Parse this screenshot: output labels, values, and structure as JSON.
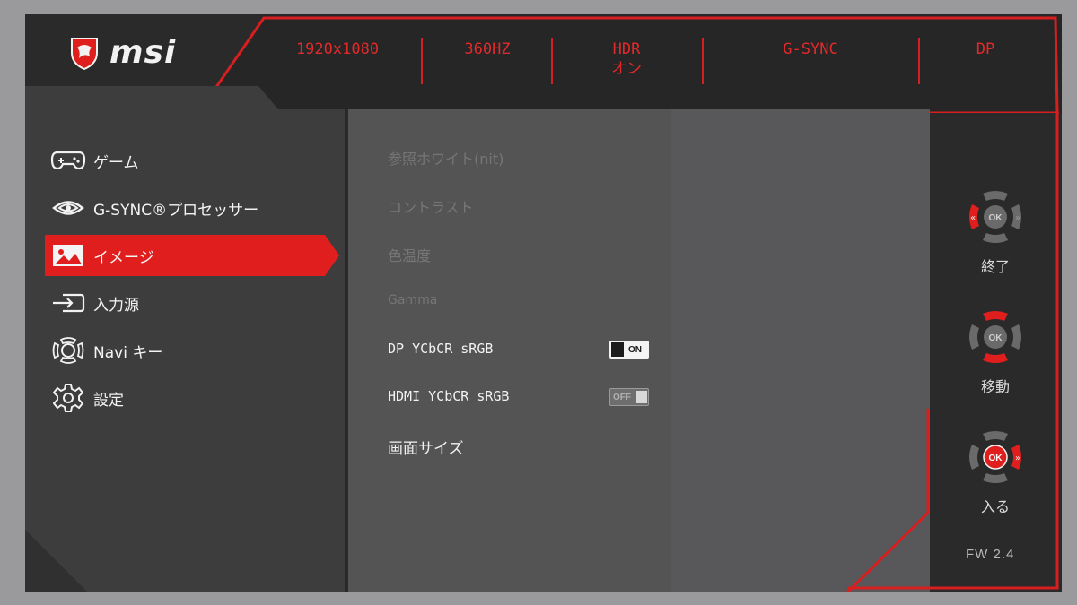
{
  "brand": {
    "name": "msi"
  },
  "status_bar": [
    {
      "text": "1920x1080"
    },
    {
      "text": "360HZ"
    },
    {
      "text": "HDR\nオン"
    },
    {
      "text": "G-SYNC"
    },
    {
      "text": "DP"
    }
  ],
  "menu": [
    {
      "label": "ゲーム",
      "icon": "gamepad-icon"
    },
    {
      "label": "G-SYNC®プロセッサー",
      "icon": "nvidia-eye-icon"
    },
    {
      "label": "イメージ",
      "icon": "image-icon",
      "active": true
    },
    {
      "label": "入力源",
      "icon": "input-source-icon"
    },
    {
      "label": "Navi キー",
      "icon": "navi-key-icon"
    },
    {
      "label": "設定",
      "icon": "gear-icon"
    }
  ],
  "settings": [
    {
      "label": "参照ホワイト(nit)",
      "enabled": false
    },
    {
      "label": "コントラスト",
      "enabled": false
    },
    {
      "label": "色温度",
      "enabled": false
    },
    {
      "label": "Gamma",
      "enabled": false
    },
    {
      "label": "DP YCbCR sRGB",
      "enabled": true,
      "toggle": "ON"
    },
    {
      "label": "HDMI YCbCR sRGB",
      "enabled": true,
      "toggle": "OFF"
    },
    {
      "label": "画面サイズ",
      "enabled": true
    }
  ],
  "nav_keys": [
    {
      "label": "終了",
      "center": "OK"
    },
    {
      "label": "移動",
      "center": "OK"
    },
    {
      "label": "入る",
      "center": "OK"
    }
  ],
  "firmware": "FW  2.4",
  "colors": {
    "accent": "#e01e1e",
    "panel": "#2b2b2c",
    "content": "#555556"
  }
}
